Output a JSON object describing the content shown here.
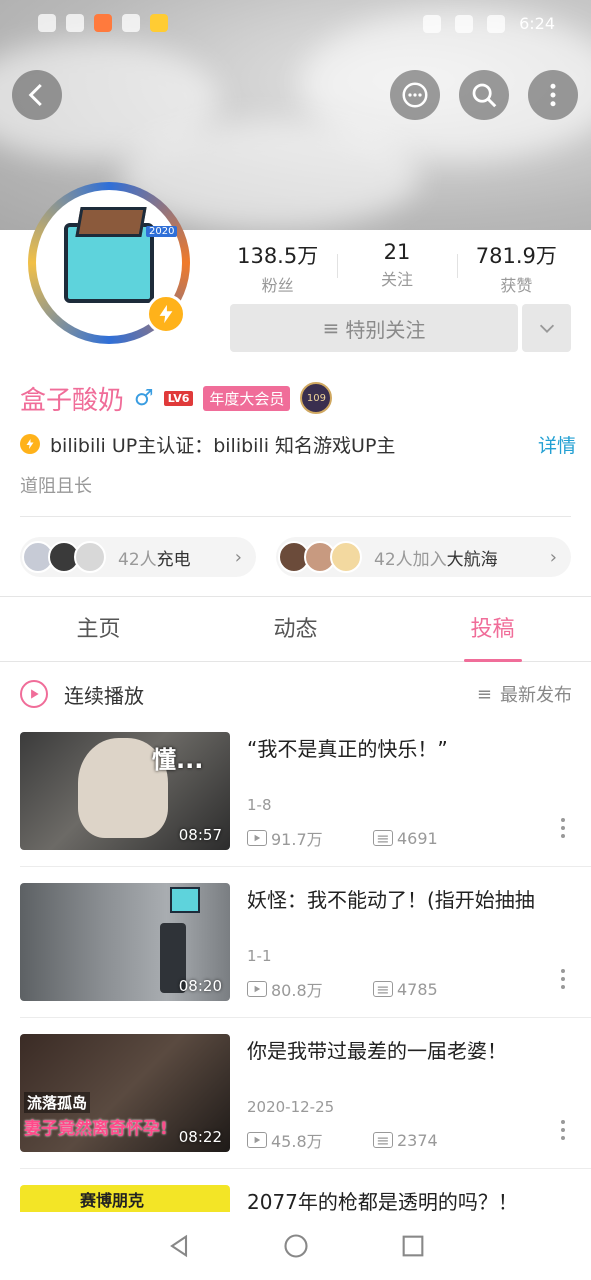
{
  "status": {
    "time": "6:24"
  },
  "profile": {
    "name": "盒子酸奶",
    "gender_symbol": "♂",
    "level": "LV6",
    "vip": "年度大会员",
    "medal": "109",
    "avatar_year": "2020",
    "cert": "bilibili UP主认证：bilibili 知名游戏UP主",
    "detail_label": "详情",
    "signature": "道阻且长"
  },
  "stats": [
    {
      "num": "138.5万",
      "label": "粉丝"
    },
    {
      "num": "21",
      "label": "关注"
    },
    {
      "num": "781.9万",
      "label": "获赞"
    }
  ],
  "follow": {
    "label": "特别关注"
  },
  "charge": {
    "count": "42人",
    "label": "充电"
  },
  "voyage": {
    "count": "42人加入",
    "label": "大航海"
  },
  "tabs": [
    {
      "label": "主页"
    },
    {
      "label": "动态"
    },
    {
      "label": "投稿"
    }
  ],
  "play": {
    "label": "连续播放",
    "sort_label": "最新发布"
  },
  "videos": [
    {
      "title": "“我不是真正的快乐！”",
      "sub": "1-8",
      "duration": "08:57",
      "views": "91.7万",
      "danmaku": "4691",
      "thumb_text": "懂..."
    },
    {
      "title": "妖怪：我不能动了！(指开始抽抽",
      "sub": "1-1",
      "duration": "08:20",
      "views": "80.8万",
      "danmaku": "4785",
      "thumb_text": ""
    },
    {
      "title": "你是我带过最差的一届老婆！",
      "sub": "2020-12-25",
      "duration": "08:22",
      "views": "45.8万",
      "danmaku": "2374",
      "thumb_text": "流落孤岛",
      "thumb_text2": "妻子竟然离奇怀孕!"
    },
    {
      "title": "2077年的枪都是透明的吗？！",
      "thumb_text": "赛博朋克"
    }
  ],
  "colors": {
    "accent": "#f06d99",
    "link": "#23a0d3",
    "bolt": "#ffb21a"
  }
}
